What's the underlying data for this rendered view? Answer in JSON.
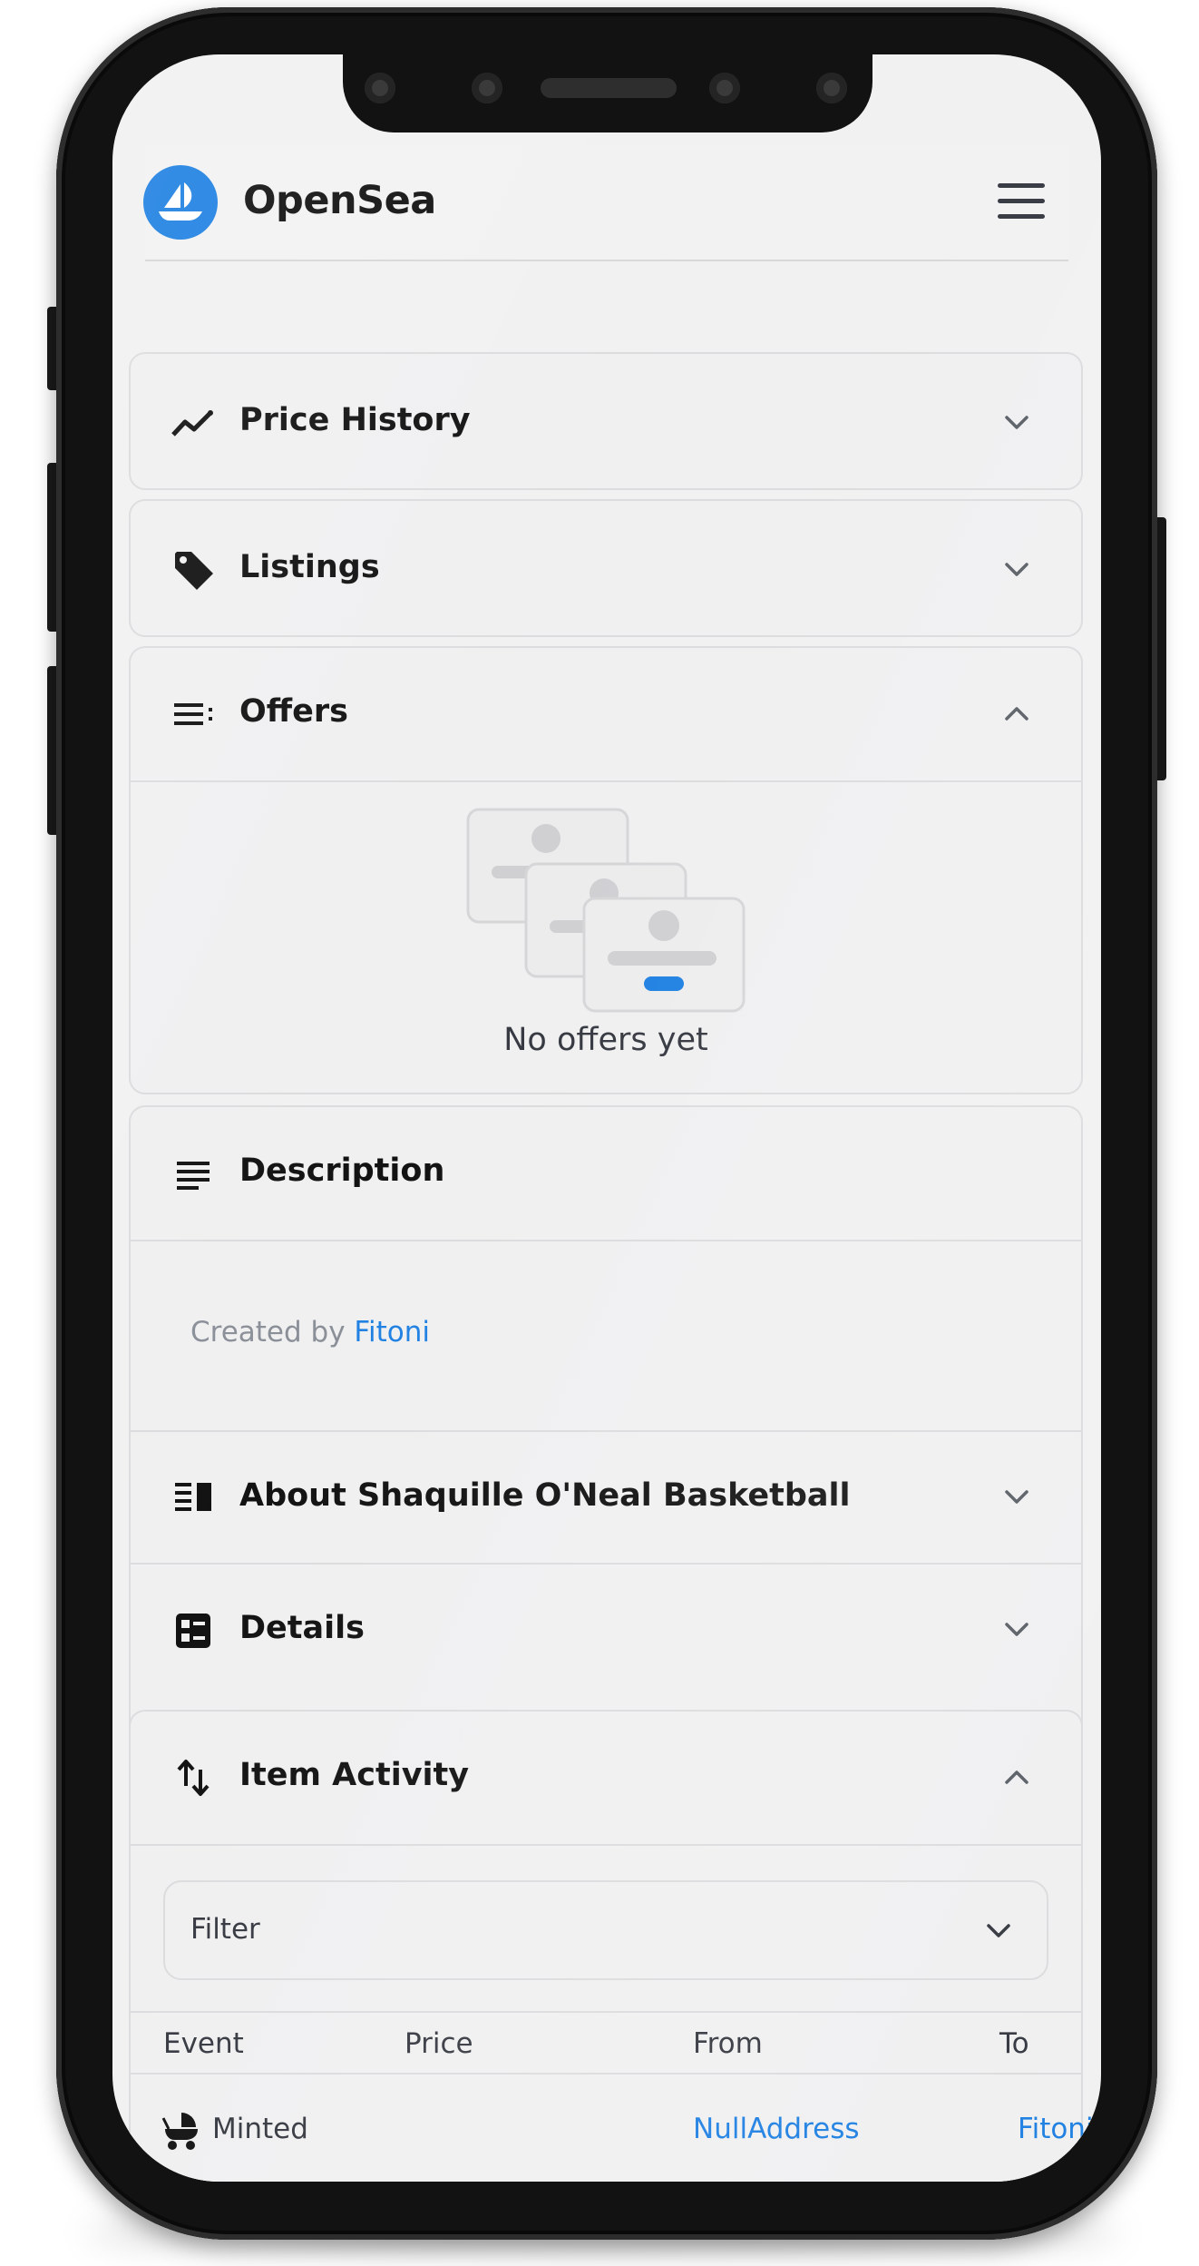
{
  "header": {
    "brand": "OpenSea",
    "logo_icon": "opensea-ship-icon",
    "menu_icon": "hamburger-menu-icon"
  },
  "colors": {
    "accent": "#2081e2",
    "text": "#121212",
    "muted": "#8a8f98",
    "panel_bg": "#f0f0f1",
    "border": "#dcdcde"
  },
  "sections": {
    "price_history": {
      "title": "Price History",
      "icon": "trend-line-icon",
      "expanded": false
    },
    "listings": {
      "title": "Listings",
      "icon": "tag-icon",
      "expanded": false
    },
    "offers": {
      "title": "Offers",
      "icon": "offers-list-icon",
      "expanded": true,
      "empty_text": "No offers yet"
    },
    "description": {
      "title": "Description",
      "icon": "text-lines-icon",
      "created_prefix": "Created by",
      "creator": "Fitoni"
    },
    "about": {
      "title": "About Shaquille O'Neal Basketball",
      "icon": "about-collection-icon",
      "expanded": false
    },
    "details": {
      "title": "Details",
      "icon": "details-grid-icon",
      "expanded": false
    },
    "item_activity": {
      "title": "Item Activity",
      "icon": "swap-arrows-icon",
      "expanded": true,
      "filter_label": "Filter",
      "columns": [
        "Event",
        "Price",
        "From",
        "To"
      ],
      "rows": [
        {
          "event": "Minted",
          "event_icon": "stroller-icon",
          "price": "",
          "from": "NullAddress",
          "to": "Fitoni"
        }
      ]
    }
  }
}
